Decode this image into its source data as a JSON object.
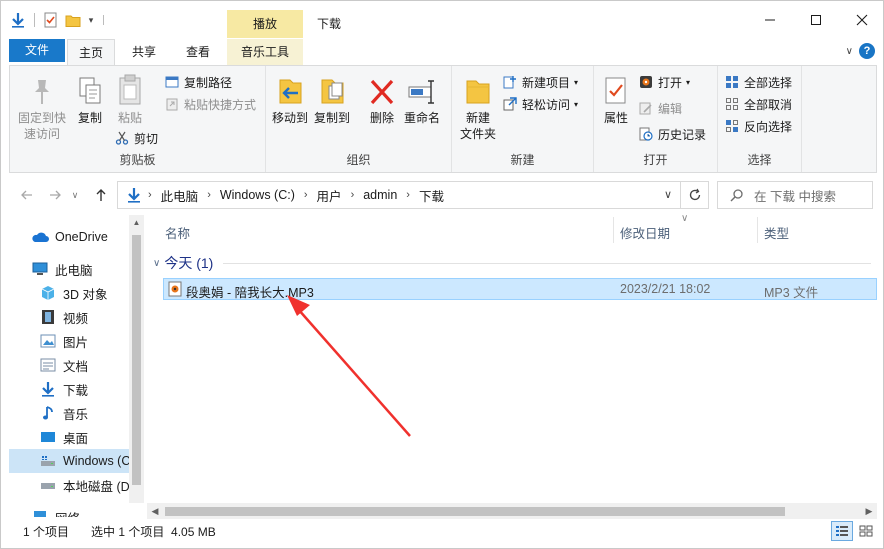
{
  "title": {
    "context_tab": "播放",
    "window_title": "下载"
  },
  "ribbon_tabs": {
    "file": "文件",
    "home": "主页",
    "share": "共享",
    "view": "查看",
    "music_tools": "音乐工具"
  },
  "ribbon": {
    "clipboard": {
      "label": "剪贴板",
      "pin_quick": "固定到快\n速访问",
      "pin_quick_l1": "固定到快",
      "pin_quick_l2": "速访问",
      "copy": "复制",
      "paste": "粘贴",
      "copy_path": "复制路径",
      "paste_shortcut": "粘贴快捷方式",
      "cut": "剪切"
    },
    "organize": {
      "label": "组织",
      "move_to": "移动到",
      "copy_to": "复制到",
      "delete": "删除",
      "rename": "重命名"
    },
    "new": {
      "label": "新建",
      "new_folder_l1": "新建",
      "new_folder_l2": "文件夹",
      "new_item": "新建项目",
      "easy_access": "轻松访问"
    },
    "open": {
      "label": "打开",
      "properties": "属性",
      "open": "打开",
      "edit": "编辑",
      "history": "历史记录"
    },
    "select": {
      "label": "选择",
      "select_all": "全部选择",
      "select_none": "全部取消",
      "invert": "反向选择"
    }
  },
  "address": {
    "crumbs": [
      "此电脑",
      "Windows (C:)",
      "用户",
      "admin",
      "下载"
    ],
    "search_placeholder": "在 下载 中搜索"
  },
  "nav_pane": {
    "items": [
      {
        "label": "OneDrive",
        "icon": "cloud-icon"
      },
      {
        "label": "此电脑",
        "icon": "computer-icon"
      },
      {
        "label": "3D 对象",
        "icon": "cube-icon"
      },
      {
        "label": "视频",
        "icon": "film-icon"
      },
      {
        "label": "图片",
        "icon": "picture-icon"
      },
      {
        "label": "文档",
        "icon": "document-icon"
      },
      {
        "label": "下载",
        "icon": "download-icon"
      },
      {
        "label": "音乐",
        "icon": "music-note-icon"
      },
      {
        "label": "桌面",
        "icon": "desktop-icon"
      },
      {
        "label": "Windows (C",
        "icon": "drive-c-icon"
      },
      {
        "label": "本地磁盘 (D",
        "icon": "drive-icon"
      },
      {
        "label": "网络",
        "icon": "network-icon"
      }
    ]
  },
  "file_list": {
    "columns": {
      "name": "名称",
      "modified": "修改日期",
      "type": "类型"
    },
    "group": "今天 (1)",
    "rows": [
      {
        "name": "段奥娟 - 陪我长大.MP3",
        "modified": "2023/2/21 18:02",
        "type": "MP3 文件"
      }
    ]
  },
  "status_bar": {
    "item_count": "1 个项目",
    "selection": "选中 1 个项目  4.05 MB"
  },
  "colors": {
    "accent": "#1979ca",
    "selection_bg": "#cce8ff",
    "annotation_arrow": "#f0312d"
  }
}
